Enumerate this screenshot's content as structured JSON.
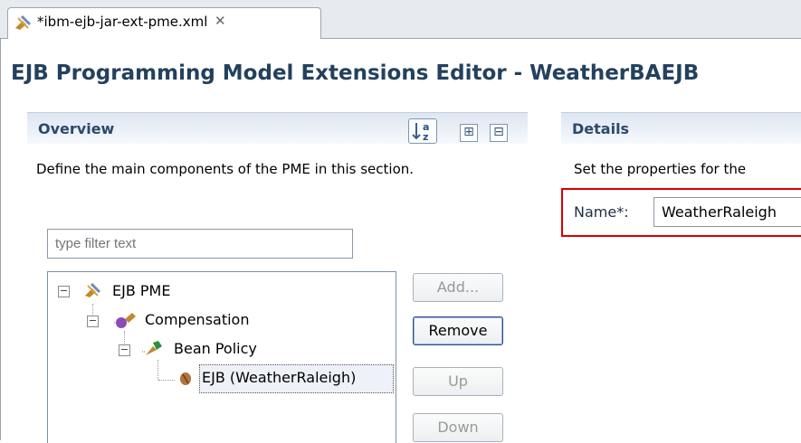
{
  "tab": {
    "title": "*ibm-ejb-jar-ext-pme.xml",
    "close": "✕"
  },
  "editor": {
    "title": "EJB Programming Model Extensions Editor - WeatherBAEJB"
  },
  "overview": {
    "title": "Overview",
    "description": "Define the main components of the PME in this section.",
    "filter_placeholder": "type filter text",
    "toolbar": {
      "sort_icon": "sort-az-icon",
      "expand": "⊞",
      "collapse": "⊟"
    }
  },
  "tree": {
    "items": [
      {
        "label": "EJB PME",
        "icon": "pme-root-icon"
      },
      {
        "label": "Compensation",
        "icon": "compensation-icon"
      },
      {
        "label": "Bean Policy",
        "icon": "bean-policy-icon"
      },
      {
        "label": "EJB (WeatherRaleigh)",
        "icon": "ejb-bean-icon",
        "selected": true
      }
    ]
  },
  "buttons": {
    "add": "Add...",
    "remove": "Remove",
    "up": "Up",
    "down": "Down"
  },
  "details": {
    "title": "Details",
    "description": "Set the properties for the",
    "name_label": "Name*:",
    "name_value": "WeatherRaleigh"
  },
  "colors": {
    "highlight_border": "#d60000",
    "section_title": "#2b4a6a"
  }
}
